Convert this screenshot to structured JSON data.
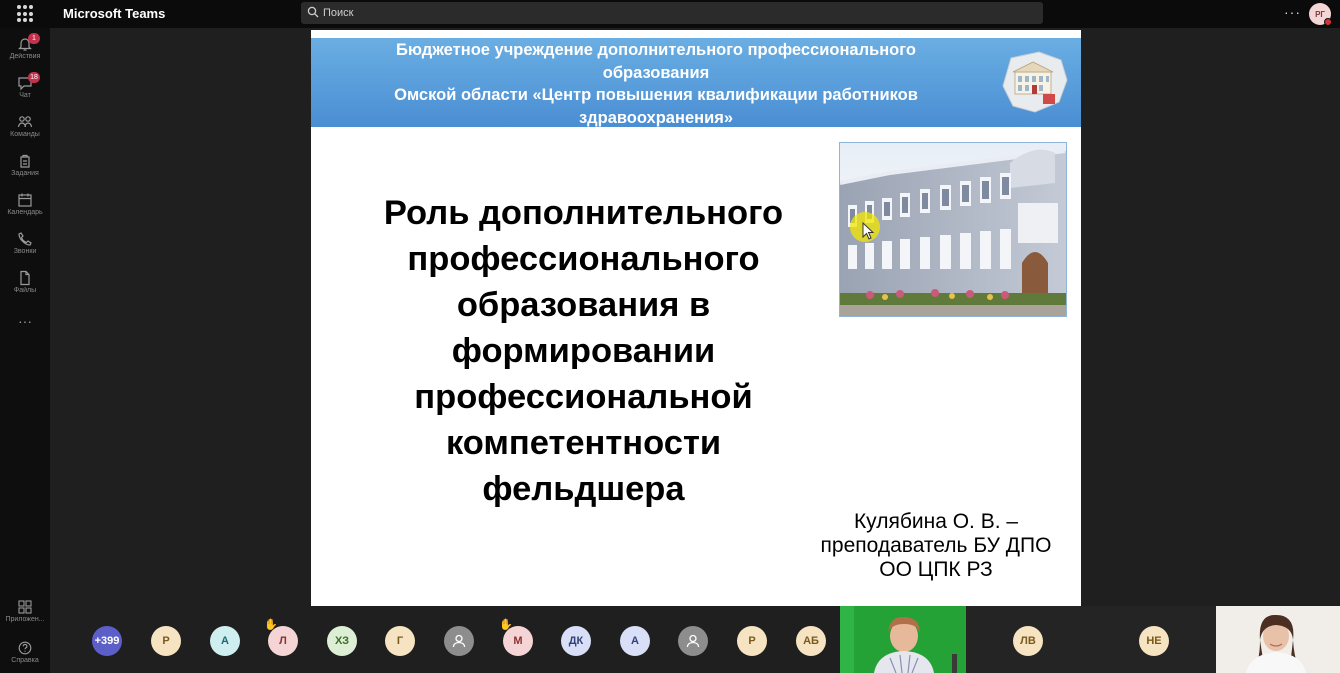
{
  "app": {
    "title": "Microsoft Teams",
    "user_initials": "РГ"
  },
  "search": {
    "placeholder": "Поиск"
  },
  "rail": {
    "items": [
      {
        "icon": "bell-icon",
        "label": "Действия",
        "badge": "1"
      },
      {
        "icon": "chat-icon",
        "label": "Чат",
        "badge": "18"
      },
      {
        "icon": "teams-icon",
        "label": "Команды",
        "badge": ""
      },
      {
        "icon": "assignments-icon",
        "label": "Задания",
        "badge": ""
      },
      {
        "icon": "calendar-icon",
        "label": "Календарь",
        "badge": ""
      },
      {
        "icon": "phone-icon",
        "label": "Звонки",
        "badge": ""
      },
      {
        "icon": "files-icon",
        "label": "Файлы",
        "badge": ""
      }
    ],
    "more": "···",
    "bottom": [
      {
        "icon": "apps-icon",
        "label": "Приложен..."
      },
      {
        "icon": "help-icon",
        "label": "Справка"
      }
    ]
  },
  "slide": {
    "header_lines": [
      "Бюджетное учреждение дополнительного профессионального",
      "образования",
      "Омской области «Центр повышения квалификации работников",
      "здравоохранения»"
    ],
    "title_lines": [
      "Роль дополнительного",
      "профессионального",
      "образования в",
      "формировании",
      "профессиональной",
      "компетентности",
      "фельдшера"
    ],
    "author_lines": [
      "Кулябина О. В. –",
      "преподаватель БУ ДПО",
      "ОО ЦПК РЗ"
    ]
  },
  "participants": {
    "overflow": "+399",
    "avatars": [
      {
        "initials": "Р",
        "bg": "#f6e3c2",
        "fg": "#7a5a1c",
        "hand": false
      },
      {
        "initials": "А",
        "bg": "#cfeef0",
        "fg": "#1d6b72",
        "hand": false
      },
      {
        "initials": "Л",
        "bg": "#f4d4d4",
        "fg": "#8a3232",
        "hand": true
      },
      {
        "initials": "ХЗ",
        "bg": "#dcefd4",
        "fg": "#3d6a2c",
        "hand": false
      },
      {
        "initials": "Г",
        "bg": "#f6e3c2",
        "fg": "#7a5a1c",
        "hand": false
      },
      {
        "initials": "",
        "bg": "#8d8d8d",
        "fg": "#ffffff",
        "hand": false
      },
      {
        "initials": "М",
        "bg": "#f4d4d4",
        "fg": "#8a3232",
        "hand": true
      },
      {
        "initials": "ДК",
        "bg": "#d8dff6",
        "fg": "#33427a",
        "hand": false
      },
      {
        "initials": "А",
        "bg": "#d8dff6",
        "fg": "#33427a",
        "hand": false
      },
      {
        "initials": "",
        "bg": "#8d8d8d",
        "fg": "#ffffff",
        "hand": false
      },
      {
        "initials": "Р",
        "bg": "#f6e3c2",
        "fg": "#7a5a1c",
        "hand": false
      },
      {
        "initials": "АБ",
        "bg": "#f6e3c2",
        "fg": "#7a5a1c",
        "hand": false
      }
    ],
    "tiles": [
      {
        "initials": "ЛВ",
        "bg": "#f6e3c2",
        "fg": "#7a5a1c"
      },
      {
        "initials": "НЕ",
        "bg": "#f6e3c2",
        "fg": "#7a5a1c"
      }
    ]
  },
  "colors": {
    "accent": "#6264a7",
    "header_blue": "#5b9edb",
    "badge_red": "#c4314b",
    "hand_raised": "#f0b400"
  }
}
